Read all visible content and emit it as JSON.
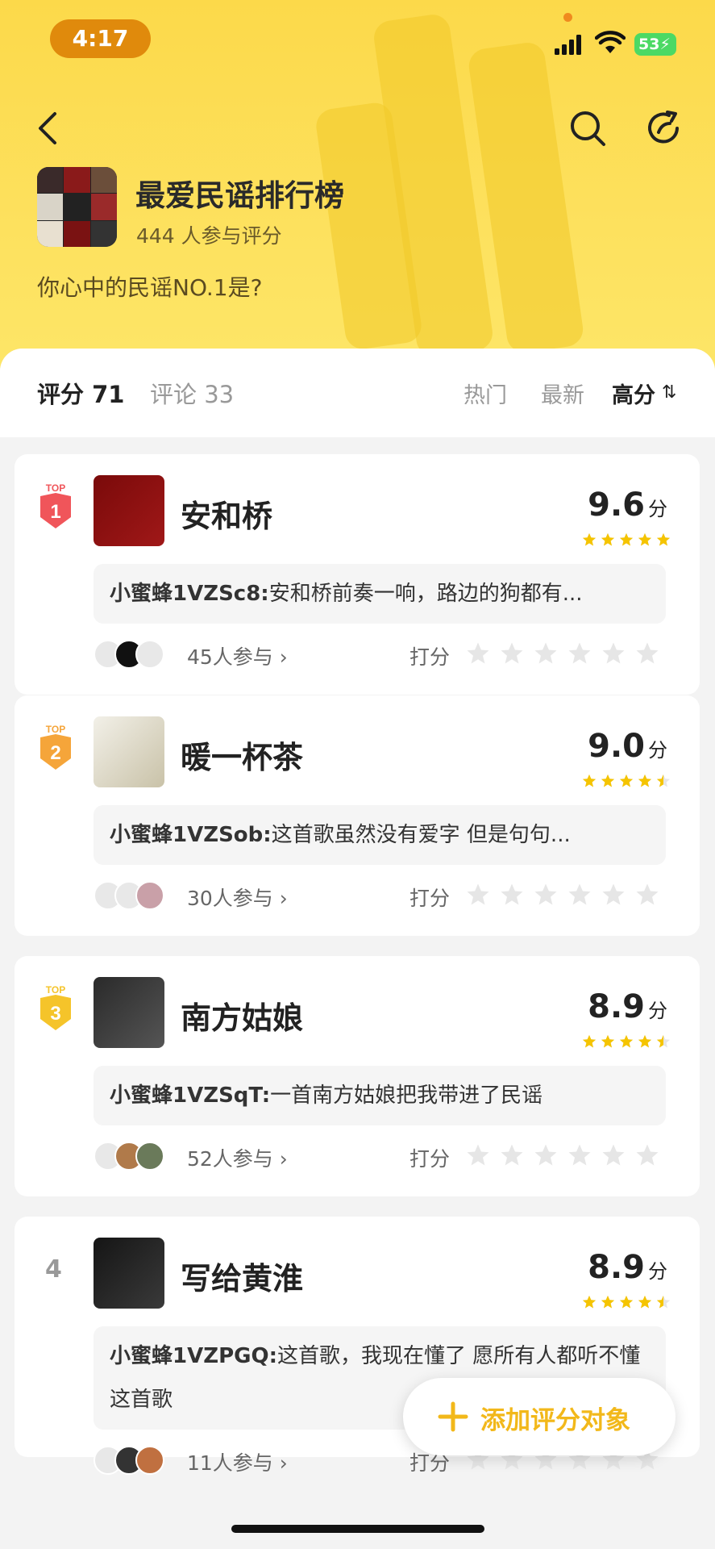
{
  "status_bar": {
    "time": "4:17",
    "battery": "53"
  },
  "header": {
    "title": "最爱民谣排行榜",
    "participants": "444 人参与评分",
    "question": "你心中的民谣NO.1是?"
  },
  "tabs": {
    "score": "评分 71",
    "comment": "评论 33"
  },
  "sort": {
    "hot": "热门",
    "new": "最新",
    "high": "高分",
    "high_icon": "⇅"
  },
  "items": [
    {
      "rank": "1",
      "top_label": "TOP",
      "name": "安和桥",
      "score": "9.6",
      "unit": "分",
      "stars": 5,
      "commenter": "小蜜蜂1VZSc8:",
      "comment": "安和桥前奏一响，路边的狗都有...",
      "join": "45人参与",
      "rate_label": "打分",
      "rank_color": "#f0555a"
    },
    {
      "rank": "2",
      "top_label": "TOP",
      "name": "暖一杯茶",
      "score": "9.0",
      "unit": "分",
      "stars": 4.5,
      "commenter": "小蜜蜂1VZSob:",
      "comment": "这首歌虽然没有爱字 但是句句...",
      "join": "30人参与",
      "rate_label": "打分",
      "rank_color": "#f5a53a"
    },
    {
      "rank": "3",
      "top_label": "TOP",
      "name": "南方姑娘",
      "score": "8.9",
      "unit": "分",
      "stars": 4.5,
      "commenter": "小蜜蜂1VZSqT:",
      "comment": "一首南方姑娘把我带进了民谣",
      "join": "52人参与",
      "rate_label": "打分",
      "rank_color": "#f5c42a"
    },
    {
      "rank": "4",
      "top_label": "",
      "name": "写给黄淮",
      "score": "8.9",
      "unit": "分",
      "stars": 4.5,
      "commenter": "小蜜蜂1VZPGQ:",
      "comment": "这首歌，我现在懂了 愿所有人都听不懂这首歌",
      "join": "11人参与",
      "rate_label": "打分",
      "rank_color": "#999999"
    }
  ],
  "fab": {
    "label": "添加评分对象"
  },
  "colors": {
    "accent": "#fcd94a",
    "star": "#f5c400",
    "star_empty": "#e6e6e6"
  }
}
